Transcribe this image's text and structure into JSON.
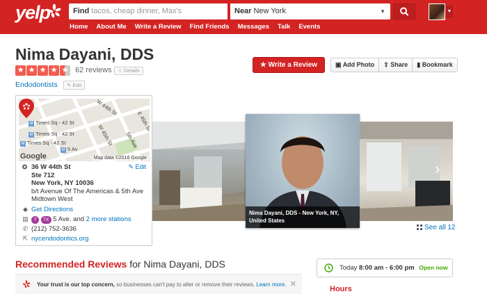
{
  "header": {
    "logo_text": "yelp",
    "search_find_label": "Find",
    "search_find_placeholder": "tacos, cheap dinner, Max's",
    "search_near_label": "Near",
    "search_near_value": "New York",
    "nav": [
      "Home",
      "About Me",
      "Write a Review",
      "Find Friends",
      "Messages",
      "Talk",
      "Events"
    ]
  },
  "business": {
    "name": "Nima Dayani, DDS",
    "rating": 4.5,
    "review_count": "62 reviews",
    "details_label": "Details",
    "category": "Endodontists",
    "edit_label": "Edit"
  },
  "actions": {
    "write_review": "Write a Review",
    "add_photo": "Add Photo",
    "share": "Share",
    "bookmark": "Bookmark"
  },
  "map": {
    "labels": [
      "W 44th St",
      "Times Sq - 42 St",
      "Times Sq - 42 St",
      "Times Sq - 42 St",
      "5 Av",
      "E 45th St",
      "W 45th St",
      "5th Ave"
    ],
    "credit": "Map data ©2016 Google",
    "google": "Google"
  },
  "address": {
    "street": "36 W 44th St",
    "suite": "Ste 712",
    "city": "New York, NY 10036",
    "cross": "b/t Avenue Of The Americas & 5th Ave",
    "neighborhood": "Midtown West",
    "edit": "Edit",
    "directions": "Get Directions",
    "transit_line1": "7",
    "transit_line2": "7X",
    "transit_text": "5 Ave. and",
    "transit_more": "2 more stations",
    "phone": "(212) 752-3636",
    "website": "nycendodontics.org"
  },
  "photos": {
    "caption": "Nima Dayani, DDS - New York, NY, United States",
    "see_all": "See all 12"
  },
  "reviews": {
    "title_red": "Recommended Reviews",
    "title_rest": "for Nima Dayani, DDS",
    "trust_bold": "Your trust is our top concern,",
    "trust_rest": "so businesses can't pay to alter or remove their reviews.",
    "learn_more": "Learn more."
  },
  "hours": {
    "today_label": "Today",
    "today_hours": "8:00 am - 6:00 pm",
    "status": "Open now",
    "title": "Hours"
  },
  "colors": {
    "brand_red": "#d32323",
    "link_blue": "#0073bb",
    "star": "#f15c4f",
    "open_green": "#41a700"
  }
}
